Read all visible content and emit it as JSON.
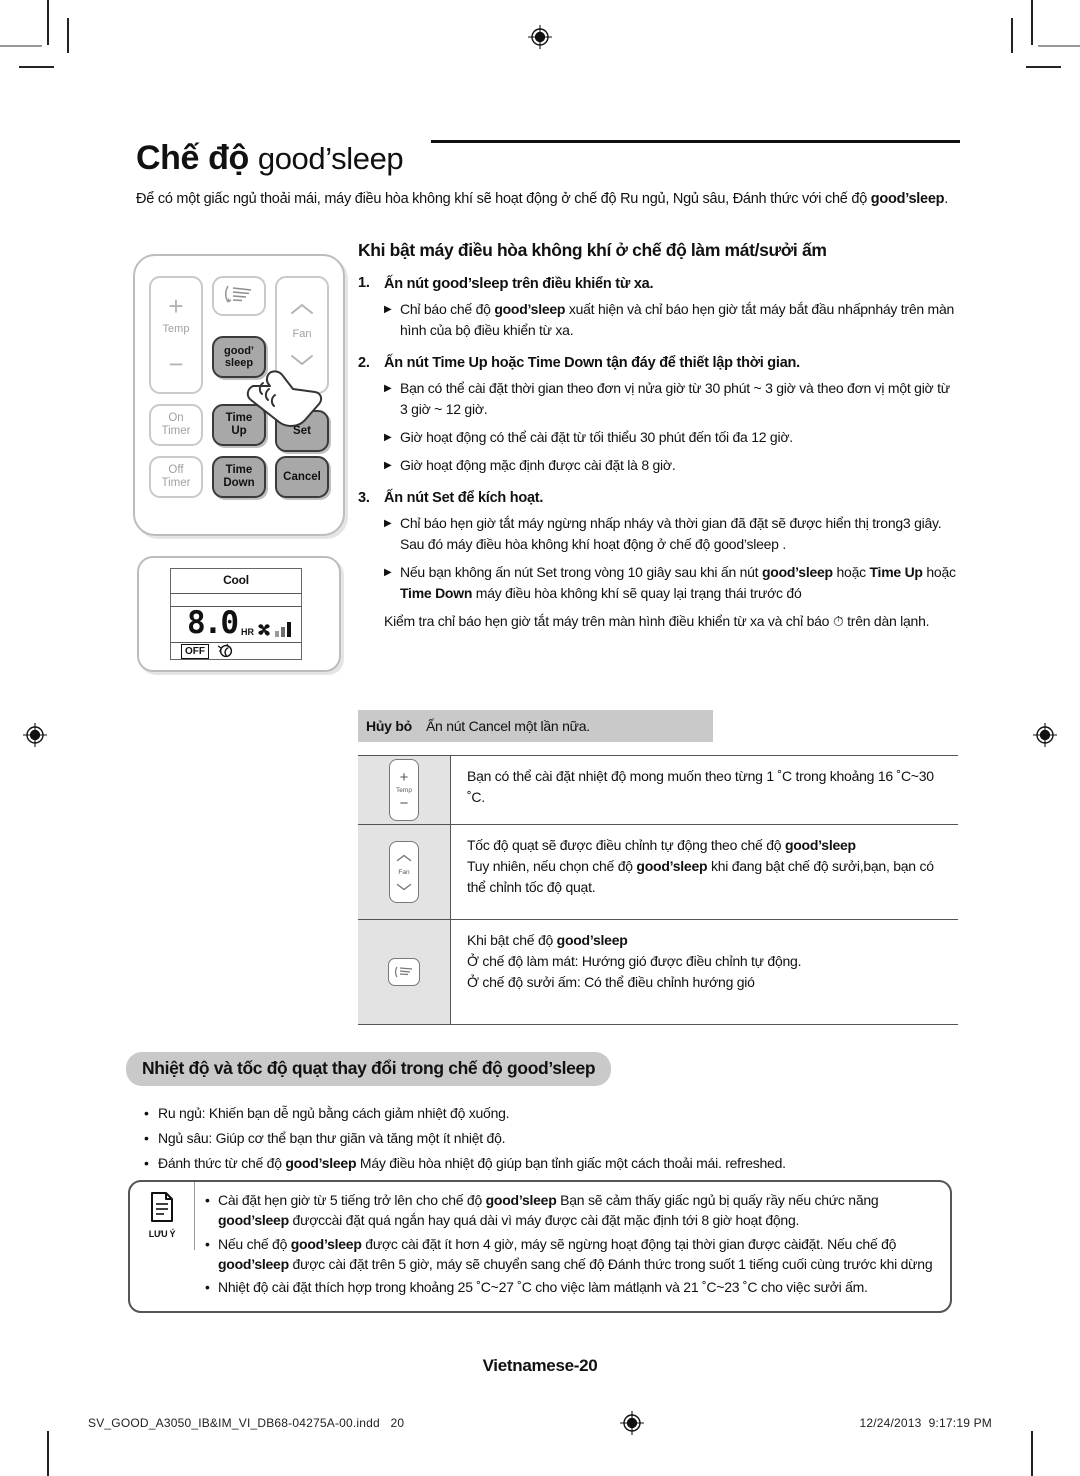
{
  "title": {
    "prefix": "Chế độ ",
    "brand": "good’sleep"
  },
  "intro": {
    "line1": "Để có một giấc ngủ thoải mái, máy điều hòa không khí sẽ hoạt động ở chế độ Ru ngủ, Ngủ sâu, Đánh thức với chế độ",
    "line2_brand": "good’sleep",
    "line2_tail": "."
  },
  "remote": {
    "temp_label": "Temp",
    "plus": "+",
    "minus": "−",
    "fan_label": "Fan",
    "chevron_up": "︿",
    "chevron_down": "﹀",
    "good_label_1": "good’",
    "good_label_2": "sleep",
    "on_timer_1": "On",
    "on_timer_2": "Timer",
    "off_timer_1": "Off",
    "off_timer_2": "Timer",
    "time_up_1": "Time",
    "time_up_2": "Up",
    "time_down_1": "Time",
    "time_down_2": "Down",
    "set": "Set",
    "cancel": "Cancel"
  },
  "lcd": {
    "mode": "Cool",
    "value": "8.0",
    "unit": "HR",
    "off_badge": "OFF"
  },
  "section1": {
    "heading": "Khi bật máy điều hòa không khí ở chế độ làm mát/sưởi ấm",
    "steps": [
      {
        "num": "1.",
        "text_pre": "Ấn nút ",
        "brand": "good’sleep",
        "text_post": " trên điều khiển từ xa.",
        "bullets": [
          {
            "pre": "Chỉ báo chế độ ",
            "brand": "good’sleep",
            "post": " xuất hiện và chỉ báo hẹn giờ tắt máy bắt đầu nhấpnháy trên màn hình của bộ điều khiển từ xa."
          }
        ]
      },
      {
        "num": "2.",
        "text_pre": "Ấn nút ",
        "bold_a": "Time Up",
        "mid": " hoặc ",
        "bold_b": "Time Down",
        "text_post": " tận đáy để thiết lập thời gian.",
        "bullets": [
          {
            "plain": "Bạn có thể cài đặt thời gian theo đơn vị nửa giờ từ 30 phút ~ 3 giờ và theo đơn vị một giờ từ 3 giờ ~ 12 giờ."
          },
          {
            "plain": "Giờ hoạt động có thể cài đặt từ tối thiểu 30 phút đến tối đa 12 giờ."
          },
          {
            "plain": "Giờ hoạt động mặc định được cài đặt là 8 giờ."
          }
        ]
      },
      {
        "num": "3.",
        "text_pre": "Ấn nút Set để kích hoạt.",
        "bullets": [
          {
            "plain": "Chỉ báo hẹn giờ tắt máy ngừng nhấp nháy và thời gian đã đặt sẽ được hiển thị trong3 giây. Sau đó máy điều hòa không khí hoạt động ở chế độ good’sleep ."
          },
          {
            "pre": "Nếu bạn không ấn nút Set trong vòng 10 giây sau khi ấn nút ",
            "brand": "good’sleep",
            "mid": " hoặc ",
            "bold_a": "Time Up",
            "mid2": " hoặc ",
            "bold_b": "Time Down",
            "post": " máy điều hòa không khí sẽ quay lại trạng thái trước đó"
          }
        ],
        "note": "Kiểm tra chỉ báo hẹn giờ tắt máy trên màn hình điều khiển từ xa và chỉ báo ⏱ trên dàn lạnh."
      }
    ]
  },
  "cancel_bar": {
    "label": "Hủy bỏ",
    "text": "Ấn nút Cancel một lần nữa."
  },
  "table": {
    "rows": [
      {
        "icon": "temp-button-icon",
        "icon_plus": "+",
        "icon_minus": "−",
        "icon_label": "Temp",
        "lines": [
          {
            "plain": "Bạn có thể cài đặt nhiệt độ mong muốn theo từng 1 ˚C trong khoảng 16 ˚C~30 ˚C."
          }
        ]
      },
      {
        "icon": "fan-button-icon",
        "icon_up": "︿",
        "icon_down": "﹀",
        "icon_label": "Fan",
        "lines": [
          {
            "pre": "Tốc độ quạt sẽ được điều chỉnh tự động theo chế độ ",
            "brand": "good’sleep",
            "post": ""
          },
          {
            "pre": "Tuy nhiên, nếu chọn chế độ ",
            "brand": "good’sleep",
            "post": " khi đang bật chế độ sưởi,bạn, bạn có thể chỉnh tốc độ quạt."
          }
        ]
      },
      {
        "icon": "airflow-button-icon",
        "lines": [
          {
            "pre": "Khi bật chế độ ",
            "brand": "good’sleep",
            "post": ""
          },
          {
            "plain": "Ở chế độ làm mát: Hướng gió được điều chỉnh tự động."
          },
          {
            "plain": "Ở chế độ sưởi ấm: Có thể điều chỉnh hướng gió"
          }
        ]
      }
    ]
  },
  "section2": {
    "heading_pre": "Nhiệt độ và tốc độ quạt thay đổi trong chế độ ",
    "heading_brand": "good’sleep",
    "bullets": [
      {
        "plain": "Ru ngủ: Khiến bạn dễ ngủ bằng cách giảm nhiệt độ xuống."
      },
      {
        "plain": "Ngủ sâu: Giúp cơ thể bạn thư giãn và tăng một ít nhiệt độ."
      },
      {
        "pre": "Đánh thức từ chế độ ",
        "brand": "good’sleep",
        "post": " Máy điều hòa nhiệt độ giúp bạn tỉnh giấc một cách thoải mái. refreshed."
      }
    ]
  },
  "note_box": {
    "icon_label": "LƯU Ý",
    "bullets": [
      {
        "pre": "Cài đặt hẹn giờ từ 5 tiếng trở lên cho chế độ ",
        "brand": "good’sleep",
        "mid": " Bạn sẽ cảm thấy giấc ngủ bị quấy rầy nếu chức năng ",
        "brand2": "good’sleep",
        "post": " đượccài đặt quá ngắn hay quá dài vì máy được cài đặt mặc định tới 8 giờ hoạt động."
      },
      {
        "pre": "Nếu chế độ ",
        "brand": "good’sleep",
        "mid": " được cài đặt ít hơn 4 giờ, máy sẽ ngừng hoạt động tại thời gian được càiđặt. Nếu chế độ ",
        "brand2": "good’sleep",
        "post": " được cài đặt trên 5 giờ, máy sẽ chuyển sang chế độ Đánh thức trong suốt 1 tiếng cuối cùng trước khi dừng"
      },
      {
        "plain": "Nhiệt độ cài đặt thích hợp trong khoảng 25 ˚C~27 ˚C cho việc làm mátlạnh và 21 ˚C~23 ˚C cho việc sưởi ấm."
      }
    ]
  },
  "footer": {
    "page_label": "Vietnamese-20",
    "file_name": "SV_GOOD_A3050_IB&IM_VI_DB68-04275A-00.indd",
    "page_number": "20",
    "date": "12/24/2013",
    "time": "9:17:19 PM"
  }
}
